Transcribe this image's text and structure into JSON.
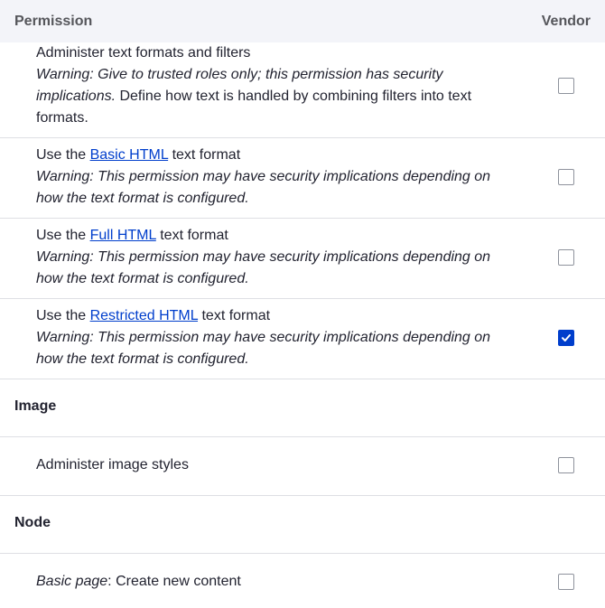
{
  "header": {
    "permission_label": "Permission",
    "role_label": "Vendor"
  },
  "rows": [
    {
      "title": "Administer text formats and filters",
      "warning": "Warning: Give to trusted roles only; this permission has security implications.",
      "desc": " Define how text is handled by combining filters into text formats.",
      "checked": false
    },
    {
      "prefix": "Use the ",
      "link": "Basic HTML",
      "suffix": " text format",
      "warning": "Warning: This permission may have security implications depending on how the text format is configured.",
      "checked": false
    },
    {
      "prefix": "Use the ",
      "link": "Full HTML",
      "suffix": " text format",
      "warning": "Warning: This permission may have security implications depending on how the text format is configured.",
      "checked": false
    },
    {
      "prefix": "Use the ",
      "link": "Restricted HTML",
      "suffix": " text format",
      "warning": "Warning: This permission may have security implications depending on how the text format is configured.",
      "checked": true
    }
  ],
  "groups": {
    "image": {
      "title": "Image",
      "item": "Administer image styles",
      "checked": false
    },
    "node": {
      "title": "Node",
      "item_italic": "Basic page",
      "item_rest": ": Create new content",
      "checked": false
    }
  },
  "colors": {
    "accent": "#003ecc",
    "header_bg": "#f3f4f9",
    "border": "#dedfe4"
  }
}
